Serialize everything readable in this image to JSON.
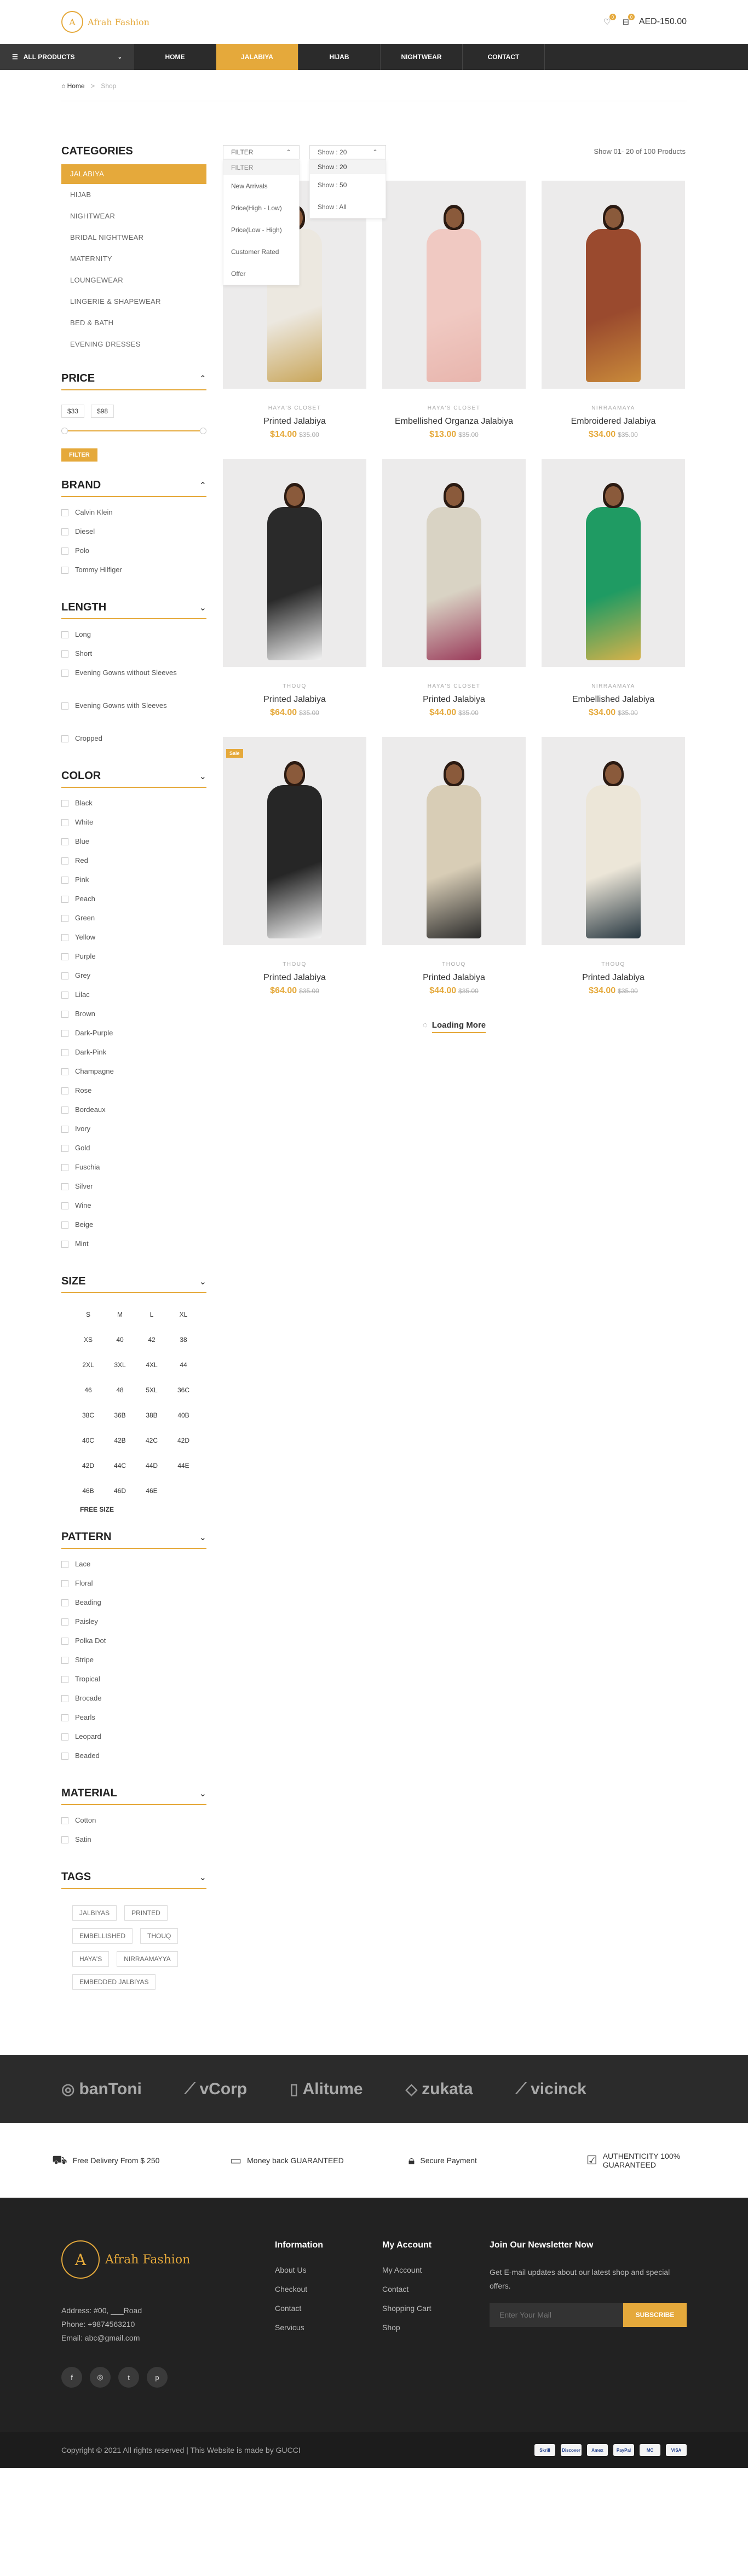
{
  "header": {
    "logo_text": "Afrah Fashion",
    "logo_letter": "A",
    "wishlist_count": "0",
    "cart_count": "0",
    "cart_total": "AED-150.00"
  },
  "nav": {
    "all_products": "ALL PRODUCTS",
    "items": [
      "HOME",
      "JALABIYA",
      "HIJAB",
      "NIGHTWEAR",
      "CONTACT"
    ],
    "active_index": 1
  },
  "breadcrumb": {
    "home": "Home",
    "current": "Shop"
  },
  "categories": {
    "title": "CATEGORIES",
    "items": [
      "JALABIYA",
      "HIJAB",
      "NIGHTWEAR",
      "BRIDAL NIGHTWEAR",
      "MATERNITY",
      "LOUNGEWEAR",
      "LINGERIE & SHAPEWEAR",
      "BED & BATH",
      "EVENING DRESSES"
    ]
  },
  "price": {
    "title": "PRICE",
    "min": "$33",
    "max": "$98",
    "button": "FILTER"
  },
  "brand": {
    "title": "BRAND",
    "items": [
      "Calvin Klein",
      "Diesel",
      "Polo",
      "Tommy Hilfiger"
    ]
  },
  "length": {
    "title": "LENGTH",
    "items": [
      "Long",
      "Short",
      "Evening Gowns without Sleeves",
      "Evening Gowns with Sleeves",
      "Cropped"
    ]
  },
  "color": {
    "title": "COLOR",
    "items": [
      "Black",
      "White",
      "Blue",
      "Red",
      "Pink",
      "Peach",
      "Green",
      "Yellow",
      "Purple",
      "Grey",
      "Lilac",
      "Brown",
      "Dark-Purple",
      "Dark-Pink",
      "Champagne",
      "Rose",
      "Bordeaux",
      "Ivory",
      "Gold",
      "Fuschia",
      "Silver",
      "Wine",
      "Beige",
      "Mint"
    ]
  },
  "size": {
    "title": "SIZE",
    "items": [
      "S",
      "M",
      "L",
      "XL",
      "XS",
      "40",
      "42",
      "38",
      "2XL",
      "3XL",
      "4XL",
      "44",
      "46",
      "48",
      "5XL",
      "36C",
      "38C",
      "36B",
      "38B",
      "40B",
      "40C",
      "42B",
      "42C",
      "42D",
      "42D",
      "44C",
      "44D",
      "44E",
      "46B",
      "46D",
      "46E"
    ],
    "free": "FREE SIZE"
  },
  "pattern": {
    "title": "PATTERN",
    "items": [
      "Lace",
      "Floral",
      "Beading",
      "Paisley",
      "Polka Dot",
      "Stripe",
      "Tropical",
      "Brocade",
      "Pearls",
      "Leopard",
      "Beaded"
    ]
  },
  "material": {
    "title": "MATERIAL",
    "items": [
      "Cotton",
      "Satin"
    ]
  },
  "tags": {
    "title": "TAGS",
    "items": [
      "JALBIYAS",
      "PRINTED",
      "EMBELLISHED",
      "THOUQ",
      "HAYA'S",
      "NIRRAAMAYYA",
      "EMBEDDED JALBIYAS"
    ]
  },
  "toolbar": {
    "filter_label": "FILTER",
    "filter_options": [
      "FILTER",
      "New Arrivals",
      "Price(High - Low)",
      "Price(Low - High)",
      "Customer Rated",
      "Offer"
    ],
    "show_label": "Show : 20",
    "show_options": [
      "Show : 20",
      "Show : 50",
      "Show : All"
    ],
    "count_text": "Show 01- 20 of 100 Products"
  },
  "products": [
    {
      "brand": "HAYA'S CLOSET",
      "name": "Printed Jalabiya",
      "price": "$14.00",
      "old": "$35.00",
      "dress": "#ece8e0",
      "accent": "#c9a65a",
      "sale": ""
    },
    {
      "brand": "HAYA'S CLOSET",
      "name": "Embellished Organza Jalabiya",
      "price": "$13.00",
      "old": "$35.00",
      "dress": "#f0c9c2",
      "accent": "#e8b5ad",
      "sale": ""
    },
    {
      "brand": "NIRRAAMAYA",
      "name": "Embroidered Jalabiya",
      "price": "$34.00",
      "old": "$35.00",
      "dress": "#9a4a2e",
      "accent": "#c98a3a",
      "sale": ""
    },
    {
      "brand": "THOUQ",
      "name": "Printed Jalabiya",
      "price": "$64.00",
      "old": "$35.00",
      "dress": "#2a2a2a",
      "accent": "#f2f2f2",
      "sale": ""
    },
    {
      "brand": "HAYA'S CLOSET",
      "name": "Printed Jalabiya",
      "price": "$44.00",
      "old": "$35.00",
      "dress": "#d9d3c4",
      "accent": "#9a3a5a",
      "sale": ""
    },
    {
      "brand": "NIRRAAMAYA",
      "name": "Embellished Jalabiya",
      "price": "$34.00",
      "old": "$35.00",
      "dress": "#1f9b63",
      "accent": "#d8b24a",
      "sale": ""
    },
    {
      "brand": "THOUQ",
      "name": "Printed Jalabiya",
      "price": "$64.00",
      "old": "$35.00",
      "dress": "#262626",
      "accent": "#f4f4f4",
      "sale": "Sale"
    },
    {
      "brand": "THOUQ",
      "name": "Printed Jalabiya",
      "price": "$44.00",
      "old": "$35.00",
      "dress": "#d8cdb6",
      "accent": "#2a2a2a",
      "sale": ""
    },
    {
      "brand": "THOUQ",
      "name": "Printed Jalabiya",
      "price": "$34.00",
      "old": "$35.00",
      "dress": "#ece6d8",
      "accent": "#263640",
      "sale": ""
    }
  ],
  "loading_more": "Loading More",
  "brands": [
    "banToni",
    "vCorp",
    "Alitume",
    "zukata",
    "vicinck"
  ],
  "features": [
    "Free Delivery From $ 250",
    "Money back GUARANTEED",
    "Secure Payment",
    "AUTHENTICITY 100% GUARANTEED"
  ],
  "footer": {
    "logo_text": "Afrah Fashion",
    "address": "Address: #00, ___Road",
    "phone": "Phone: +9874563210",
    "email": "Email: abc@gmail.com",
    "info_title": "Information",
    "info_links": [
      "About Us",
      "Checkout",
      "Contact",
      "Servicus"
    ],
    "account_title": "My Account",
    "account_links": [
      "My Account",
      "Contact",
      "Shopping Cart",
      "Shop"
    ],
    "news_title": "Join Our Newsletter Now",
    "news_text": "Get E-mail updates about our latest shop and special offers.",
    "news_placeholder": "Enter Your Mail",
    "news_button": "SUBSCRIBE",
    "copyright": "Copyright © 2021 All rights reserved | This Website is made by GUCCI",
    "payments": [
      "Skrill",
      "Discover",
      "Amex",
      "PayPal",
      "MC",
      "VISA"
    ]
  },
  "colors": {
    "accent": "#e5a93b",
    "nav_bg": "#2b2b2b",
    "footer_bg": "#222222"
  }
}
